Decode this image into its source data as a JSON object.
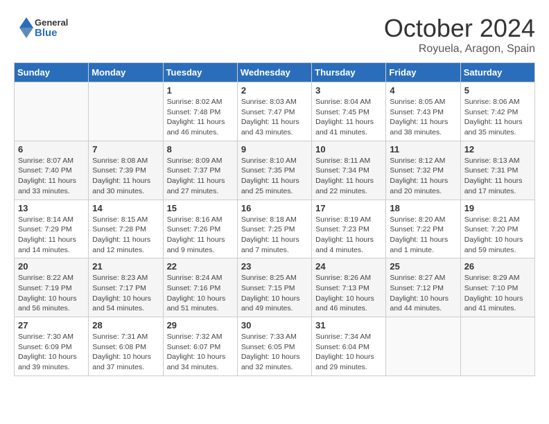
{
  "header": {
    "logo": {
      "line1": "General",
      "line2": "Blue"
    },
    "title": "October 2024",
    "subtitle": "Royuela, Aragon, Spain"
  },
  "calendar": {
    "days_of_week": [
      "Sunday",
      "Monday",
      "Tuesday",
      "Wednesday",
      "Thursday",
      "Friday",
      "Saturday"
    ],
    "weeks": [
      [
        {
          "day": "",
          "info": ""
        },
        {
          "day": "",
          "info": ""
        },
        {
          "day": "1",
          "info": "Sunrise: 8:02 AM\nSunset: 7:48 PM\nDaylight: 11 hours and 46 minutes."
        },
        {
          "day": "2",
          "info": "Sunrise: 8:03 AM\nSunset: 7:47 PM\nDaylight: 11 hours and 43 minutes."
        },
        {
          "day": "3",
          "info": "Sunrise: 8:04 AM\nSunset: 7:45 PM\nDaylight: 11 hours and 41 minutes."
        },
        {
          "day": "4",
          "info": "Sunrise: 8:05 AM\nSunset: 7:43 PM\nDaylight: 11 hours and 38 minutes."
        },
        {
          "day": "5",
          "info": "Sunrise: 8:06 AM\nSunset: 7:42 PM\nDaylight: 11 hours and 35 minutes."
        }
      ],
      [
        {
          "day": "6",
          "info": "Sunrise: 8:07 AM\nSunset: 7:40 PM\nDaylight: 11 hours and 33 minutes."
        },
        {
          "day": "7",
          "info": "Sunrise: 8:08 AM\nSunset: 7:39 PM\nDaylight: 11 hours and 30 minutes."
        },
        {
          "day": "8",
          "info": "Sunrise: 8:09 AM\nSunset: 7:37 PM\nDaylight: 11 hours and 27 minutes."
        },
        {
          "day": "9",
          "info": "Sunrise: 8:10 AM\nSunset: 7:35 PM\nDaylight: 11 hours and 25 minutes."
        },
        {
          "day": "10",
          "info": "Sunrise: 8:11 AM\nSunset: 7:34 PM\nDaylight: 11 hours and 22 minutes."
        },
        {
          "day": "11",
          "info": "Sunrise: 8:12 AM\nSunset: 7:32 PM\nDaylight: 11 hours and 20 minutes."
        },
        {
          "day": "12",
          "info": "Sunrise: 8:13 AM\nSunset: 7:31 PM\nDaylight: 11 hours and 17 minutes."
        }
      ],
      [
        {
          "day": "13",
          "info": "Sunrise: 8:14 AM\nSunset: 7:29 PM\nDaylight: 11 hours and 14 minutes."
        },
        {
          "day": "14",
          "info": "Sunrise: 8:15 AM\nSunset: 7:28 PM\nDaylight: 11 hours and 12 minutes."
        },
        {
          "day": "15",
          "info": "Sunrise: 8:16 AM\nSunset: 7:26 PM\nDaylight: 11 hours and 9 minutes."
        },
        {
          "day": "16",
          "info": "Sunrise: 8:18 AM\nSunset: 7:25 PM\nDaylight: 11 hours and 7 minutes."
        },
        {
          "day": "17",
          "info": "Sunrise: 8:19 AM\nSunset: 7:23 PM\nDaylight: 11 hours and 4 minutes."
        },
        {
          "day": "18",
          "info": "Sunrise: 8:20 AM\nSunset: 7:22 PM\nDaylight: 11 hours and 1 minute."
        },
        {
          "day": "19",
          "info": "Sunrise: 8:21 AM\nSunset: 7:20 PM\nDaylight: 10 hours and 59 minutes."
        }
      ],
      [
        {
          "day": "20",
          "info": "Sunrise: 8:22 AM\nSunset: 7:19 PM\nDaylight: 10 hours and 56 minutes."
        },
        {
          "day": "21",
          "info": "Sunrise: 8:23 AM\nSunset: 7:17 PM\nDaylight: 10 hours and 54 minutes."
        },
        {
          "day": "22",
          "info": "Sunrise: 8:24 AM\nSunset: 7:16 PM\nDaylight: 10 hours and 51 minutes."
        },
        {
          "day": "23",
          "info": "Sunrise: 8:25 AM\nSunset: 7:15 PM\nDaylight: 10 hours and 49 minutes."
        },
        {
          "day": "24",
          "info": "Sunrise: 8:26 AM\nSunset: 7:13 PM\nDaylight: 10 hours and 46 minutes."
        },
        {
          "day": "25",
          "info": "Sunrise: 8:27 AM\nSunset: 7:12 PM\nDaylight: 10 hours and 44 minutes."
        },
        {
          "day": "26",
          "info": "Sunrise: 8:29 AM\nSunset: 7:10 PM\nDaylight: 10 hours and 41 minutes."
        }
      ],
      [
        {
          "day": "27",
          "info": "Sunrise: 7:30 AM\nSunset: 6:09 PM\nDaylight: 10 hours and 39 minutes."
        },
        {
          "day": "28",
          "info": "Sunrise: 7:31 AM\nSunset: 6:08 PM\nDaylight: 10 hours and 37 minutes."
        },
        {
          "day": "29",
          "info": "Sunrise: 7:32 AM\nSunset: 6:07 PM\nDaylight: 10 hours and 34 minutes."
        },
        {
          "day": "30",
          "info": "Sunrise: 7:33 AM\nSunset: 6:05 PM\nDaylight: 10 hours and 32 minutes."
        },
        {
          "day": "31",
          "info": "Sunrise: 7:34 AM\nSunset: 6:04 PM\nDaylight: 10 hours and 29 minutes."
        },
        {
          "day": "",
          "info": ""
        },
        {
          "day": "",
          "info": ""
        }
      ]
    ]
  }
}
